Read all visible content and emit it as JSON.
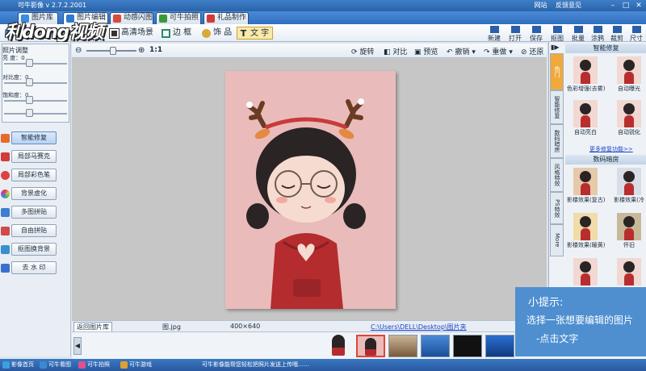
{
  "app": {
    "title": "可牛影像 v 2.7.2.2001",
    "title_links": [
      "网站",
      "反馈意见"
    ],
    "watermark": "利dong视频"
  },
  "tabs": [
    {
      "label": "图片库",
      "color": "#3a8de0"
    },
    {
      "label": "图片编辑",
      "color": "#2f7bd1"
    },
    {
      "label": "动感闪图",
      "color": "#d84b3a"
    },
    {
      "label": "可牛拍照",
      "color": "#3a9a3a"
    },
    {
      "label": "礼品制作",
      "color": "#d23a3a"
    }
  ],
  "toolbar": {
    "left_items": [
      {
        "label": "编",
        "icon": "edit-icon"
      },
      {
        "label": "高清场景",
        "icon": "scene-icon"
      },
      {
        "label": "边 框",
        "icon": "frame-icon"
      },
      {
        "label": "饰 品",
        "icon": "ornament-icon"
      },
      {
        "label": "文 字",
        "icon": "text-icon"
      }
    ],
    "right_items": [
      {
        "label": "新建",
        "icon": "new-icon"
      },
      {
        "label": "打开",
        "icon": "open-icon"
      },
      {
        "label": "保存",
        "icon": "save-icon"
      },
      {
        "label": "抠图",
        "icon": "cutout-icon"
      },
      {
        "label": "批量",
        "icon": "batch-icon"
      },
      {
        "label": "涂鸦",
        "icon": "doodle-icon"
      },
      {
        "label": "裁剪",
        "icon": "crop-icon"
      },
      {
        "label": "尺寸",
        "icon": "resize-icon"
      }
    ]
  },
  "left_panel": {
    "adjust_title": "照片调整",
    "sliders": [
      {
        "label": "亮 度：0",
        "value": 0.38
      },
      {
        "label": "对比度：0",
        "value": 0.38
      },
      {
        "label": "饱和度：0",
        "value": 0.38
      },
      {
        "label": "",
        "value": 0.38
      }
    ],
    "buttons": [
      {
        "label": "智能修复",
        "icon_color": "#e76a2d",
        "selected": true
      },
      {
        "label": "局部马赛克",
        "icon_color": "#d33a3a",
        "selected": false
      },
      {
        "label": "局部彩色笔",
        "icon_color": "#e04040",
        "selected": false
      },
      {
        "label": "背景虚化",
        "icon_color": "#c85ad0",
        "selected": false
      },
      {
        "label": "多图拼贴",
        "icon_color": "#3a7fd0",
        "selected": false
      },
      {
        "label": "自由拼贴",
        "icon_color": "#d04a4a",
        "selected": false
      },
      {
        "label": "抠图换背景",
        "icon_color": "#3a8fd0",
        "selected": false
      },
      {
        "label": "去 水 印",
        "icon_color": "#3a6fd0",
        "selected": false
      }
    ]
  },
  "canvas_toolbar": {
    "zoom_label": "1:1",
    "zoom_value": 0.52,
    "items": [
      {
        "label": "旋转",
        "icon": "rotate-icon"
      },
      {
        "label": "对比",
        "icon": "compare-icon"
      },
      {
        "label": "预览",
        "icon": "preview-icon"
      },
      {
        "label": "撤销",
        "icon": "undo-icon"
      },
      {
        "label": "重做",
        "icon": "redo-icon"
      },
      {
        "label": "还原",
        "icon": "restore-icon"
      }
    ]
  },
  "info_bar": {
    "back_button": "返回图片库",
    "filename": "图.jpg",
    "dimensions": "400×640",
    "path": "C:\\Users\\DELL\\Desktop\\图片夹"
  },
  "right_panel": {
    "vertical_tabs": [
      "热门",
      "智能修复",
      "数码暗房",
      "风格特效",
      "PS特效",
      "More"
    ],
    "section1_title": "智能修复",
    "section1_items": [
      "色彩增强(去雾)",
      "自动曝光",
      "自动亮白",
      "自动锐化"
    ],
    "more_link": "更多修复功能>>",
    "section2_title": "数码暗房",
    "section2_items": [
      "影楼效果(复古)",
      "影楼效果(冷",
      "影楼效果(暖黄)",
      "怀旧"
    ]
  },
  "tip": {
    "title": "小提示:",
    "line1": "选择一张想要编辑的图片",
    "line2": "-点击文字"
  },
  "taskbar": {
    "items": [
      {
        "label": "影像首页",
        "color": "#3aa0e0"
      },
      {
        "label": "可牛看图",
        "color": "#3a8ad0"
      },
      {
        "label": "可牛拍照",
        "color": "#e05090"
      },
      {
        "label": "可牛游戏",
        "color": "#e0a030"
      }
    ],
    "status": "可牛影像能帮您轻松把照片发送上传哦……"
  }
}
